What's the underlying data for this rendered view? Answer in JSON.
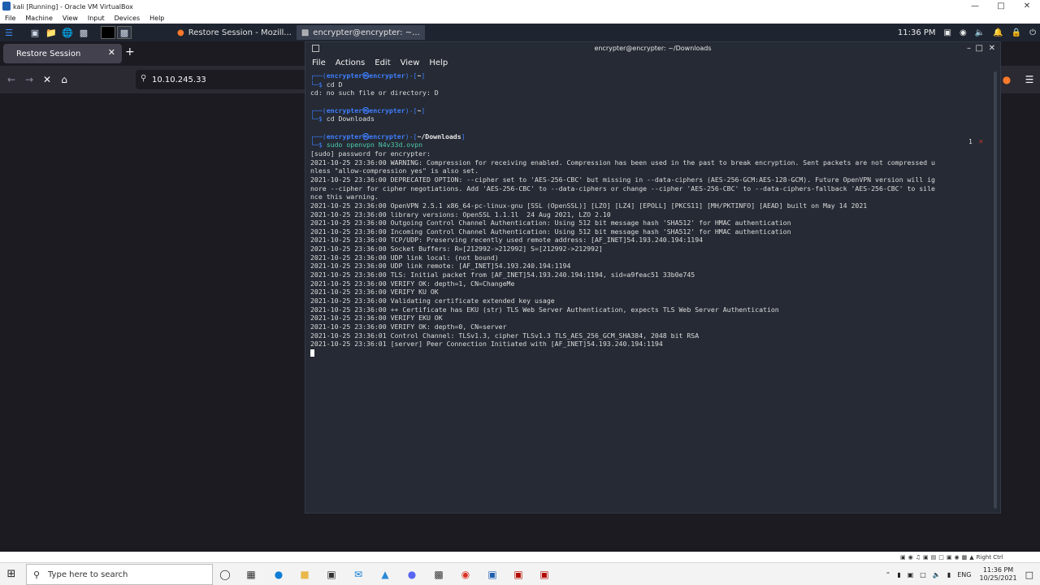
{
  "vbox": {
    "title": "kali [Running] - Oracle VM VirtualBox",
    "menu": [
      "File",
      "Machine",
      "View",
      "Input",
      "Devices",
      "Help"
    ],
    "status_right_ctrl": "Right Ctrl"
  },
  "kali_panel": {
    "task_firefox": "Restore Session - Mozill...",
    "task_terminal": "encrypter@encrypter: ~...",
    "clock": "11:36 PM"
  },
  "firefox": {
    "tab_label": "Restore Session",
    "url": "10.10.245.33"
  },
  "terminal": {
    "title": "encrypter@encrypter: ~/Downloads",
    "menu": [
      "File",
      "Actions",
      "Edit",
      "View",
      "Help"
    ],
    "side_number": "1",
    "lines": [
      {
        "kind": "prompt",
        "user": "encrypter㉿encrypter",
        "path": "~",
        "cmd": "cd D"
      },
      {
        "kind": "out",
        "text": "cd: no such file or directory: D"
      },
      {
        "kind": "blank"
      },
      {
        "kind": "prompt",
        "user": "encrypter㉿encrypter",
        "path": "~",
        "cmd": "cd Downloads"
      },
      {
        "kind": "blank"
      },
      {
        "kind": "prompt",
        "user": "encrypter㉿encrypter",
        "path": "~/Downloads",
        "cmd": "sudo openvpn N4v33d.ovpn"
      },
      {
        "kind": "out",
        "text": "[sudo] password for encrypter:"
      },
      {
        "kind": "out",
        "text": "2021-10-25 23:36:00 WARNING: Compression for receiving enabled. Compression has been used in the past to break encryption. Sent packets are not compressed u"
      },
      {
        "kind": "out",
        "text": "nless \"allow-compression yes\" is also set."
      },
      {
        "kind": "out",
        "text": "2021-10-25 23:36:00 DEPRECATED OPTION: --cipher set to 'AES-256-CBC' but missing in --data-ciphers (AES-256-GCM:AES-128-GCM). Future OpenVPN version will ig"
      },
      {
        "kind": "out",
        "text": "nore --cipher for cipher negotiations. Add 'AES-256-CBC' to --data-ciphers or change --cipher 'AES-256-CBC' to --data-ciphers-fallback 'AES-256-CBC' to sile"
      },
      {
        "kind": "out",
        "text": "nce this warning."
      },
      {
        "kind": "out",
        "text": "2021-10-25 23:36:00 OpenVPN 2.5.1 x86_64-pc-linux-gnu [SSL (OpenSSL)] [LZO] [LZ4] [EPOLL] [PKCS11] [MH/PKTINFO] [AEAD] built on May 14 2021"
      },
      {
        "kind": "out",
        "text": "2021-10-25 23:36:00 library versions: OpenSSL 1.1.1l  24 Aug 2021, LZO 2.10"
      },
      {
        "kind": "out",
        "text": "2021-10-25 23:36:00 Outgoing Control Channel Authentication: Using 512 bit message hash 'SHA512' for HMAC authentication"
      },
      {
        "kind": "out",
        "text": "2021-10-25 23:36:00 Incoming Control Channel Authentication: Using 512 bit message hash 'SHA512' for HMAC authentication"
      },
      {
        "kind": "out",
        "text": "2021-10-25 23:36:00 TCP/UDP: Preserving recently used remote address: [AF_INET]54.193.240.194:1194"
      },
      {
        "kind": "out",
        "text": "2021-10-25 23:36:00 Socket Buffers: R=[212992->212992] S=[212992->212992]"
      },
      {
        "kind": "out",
        "text": "2021-10-25 23:36:00 UDP link local: (not bound)"
      },
      {
        "kind": "out",
        "text": "2021-10-25 23:36:00 UDP link remote: [AF_INET]54.193.240.194:1194"
      },
      {
        "kind": "out",
        "text": "2021-10-25 23:36:00 TLS: Initial packet from [AF_INET]54.193.240.194:1194, sid=a9feac51 33b0e745"
      },
      {
        "kind": "out",
        "text": "2021-10-25 23:36:00 VERIFY OK: depth=1, CN=ChangeMe"
      },
      {
        "kind": "out",
        "text": "2021-10-25 23:36:00 VERIFY KU OK"
      },
      {
        "kind": "out",
        "text": "2021-10-25 23:36:00 Validating certificate extended key usage"
      },
      {
        "kind": "out",
        "text": "2021-10-25 23:36:00 ++ Certificate has EKU (str) TLS Web Server Authentication, expects TLS Web Server Authentication"
      },
      {
        "kind": "out",
        "text": "2021-10-25 23:36:00 VERIFY EKU OK"
      },
      {
        "kind": "out",
        "text": "2021-10-25 23:36:00 VERIFY OK: depth=0, CN=server"
      },
      {
        "kind": "out",
        "text": "2021-10-25 23:36:01 Control Channel: TLSv1.3, cipher TLSv1.3 TLS_AES_256_GCM_SHA384, 2048 bit RSA"
      },
      {
        "kind": "out",
        "text": "2021-10-25 23:36:01 [server] Peer Connection Initiated with [AF_INET]54.193.240.194:1194"
      },
      {
        "kind": "cursor"
      }
    ]
  },
  "windows": {
    "search_placeholder": "Type here to search",
    "tray_lang": "ENG",
    "clock_time": "11:36 PM",
    "clock_date": "10/25/2021"
  },
  "colors": {
    "kali_panel": "#1f2530",
    "terminal_bg": "#252a34",
    "prompt_blue": "#3f7fff",
    "firefox_bg": "#1c1b22"
  }
}
